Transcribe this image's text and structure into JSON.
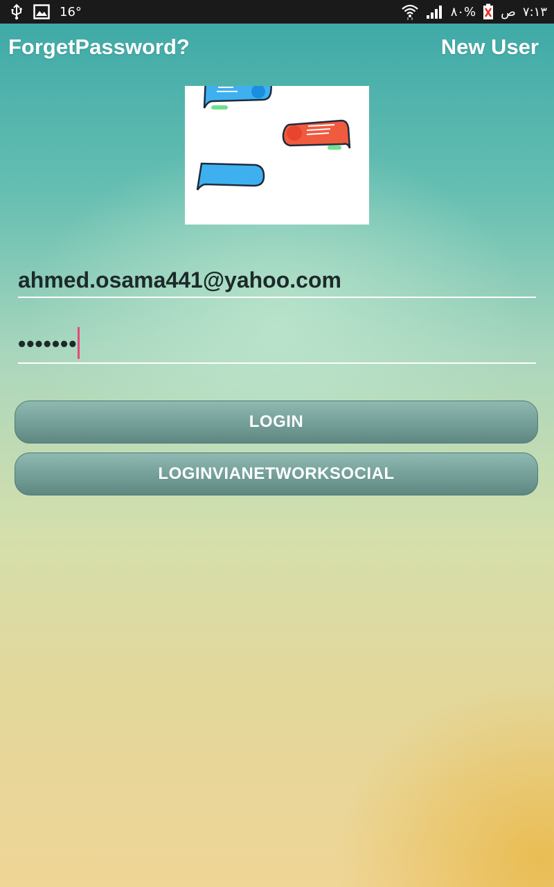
{
  "status_bar": {
    "temperature": "16°",
    "battery_percent": "٨٠%",
    "time": "٧:١٣",
    "am_pm": "ص",
    "icons": [
      "usb-icon",
      "image-icon",
      "wifi-icon",
      "signal-icon",
      "battery-icon"
    ]
  },
  "header": {
    "forget_password": "ForgetPassword?",
    "new_user": "New User"
  },
  "form": {
    "email_value": "ahmed.osama441@yahoo.com",
    "password_value": "•••••••"
  },
  "buttons": {
    "login": "LOGIN",
    "login_social": "LOGINVIANETWORKSOCIAL"
  },
  "colors": {
    "cursor": "#e8457a",
    "button": "#78a39c",
    "chat_blue": "#3fb0ef",
    "chat_red": "#f05a3e"
  }
}
